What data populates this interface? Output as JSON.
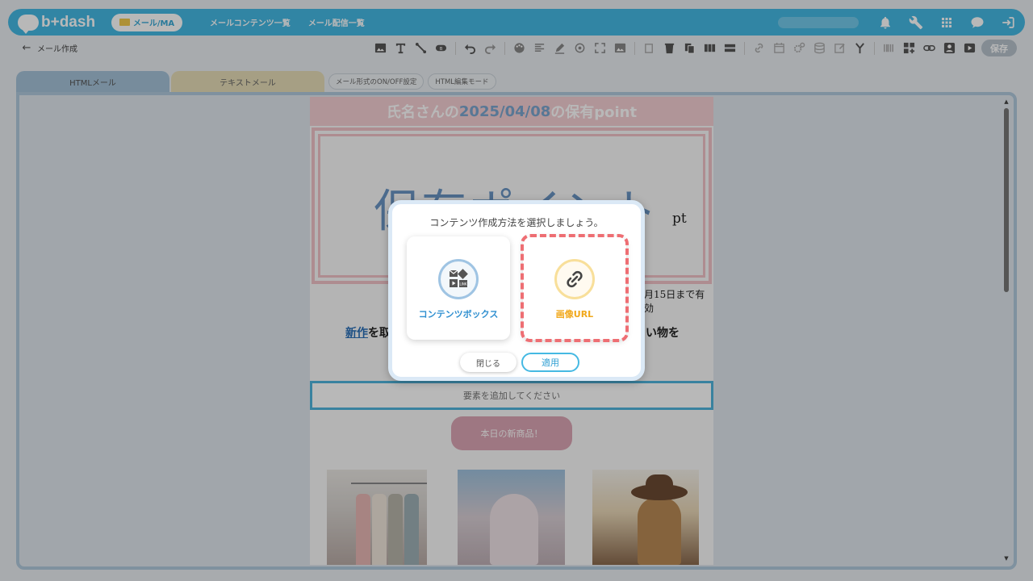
{
  "app": {
    "logo_text": "b+dash",
    "current_module": "メール/MA"
  },
  "nav": {
    "links": [
      "メールコンテンツ一覧",
      "メール配信一覧"
    ]
  },
  "topbar_icons": [
    "bell-icon",
    "wrench-icon",
    "grid-icon",
    "chat-icon",
    "logout-icon"
  ],
  "toolbar": {
    "back": "←",
    "breadcrumb": "メール作成",
    "save_label": "保存",
    "badge": "B"
  },
  "tabs": {
    "html": "HTMLメール",
    "text": "テキストメール",
    "on_off": "メール形式のON/OFF設定",
    "html_edit": "HTML編集モード"
  },
  "canvas": {
    "header_prefix": "氏名さんの",
    "header_date": "2025/04/08",
    "header_suffix": "の保有point",
    "big_text": "保有ポイント",
    "unit": "pt",
    "validity": "月15日まで有効",
    "promo_link": "新作",
    "promo_mid": "を取",
    "promo_tail": "い物を",
    "add_element": "要素を追加してください",
    "new_button": "本日の新商品！"
  },
  "modal": {
    "title": "コンテンツ作成方法を選択しましょう。",
    "option1": "コンテンツボックス",
    "option2": "画像URL",
    "close": "閉じる",
    "apply": "適用"
  },
  "colors": {
    "brand": "#45b9e3",
    "selection": "#ee6e73",
    "option1": "#2f8fd0",
    "option2": "#f1a81b"
  }
}
